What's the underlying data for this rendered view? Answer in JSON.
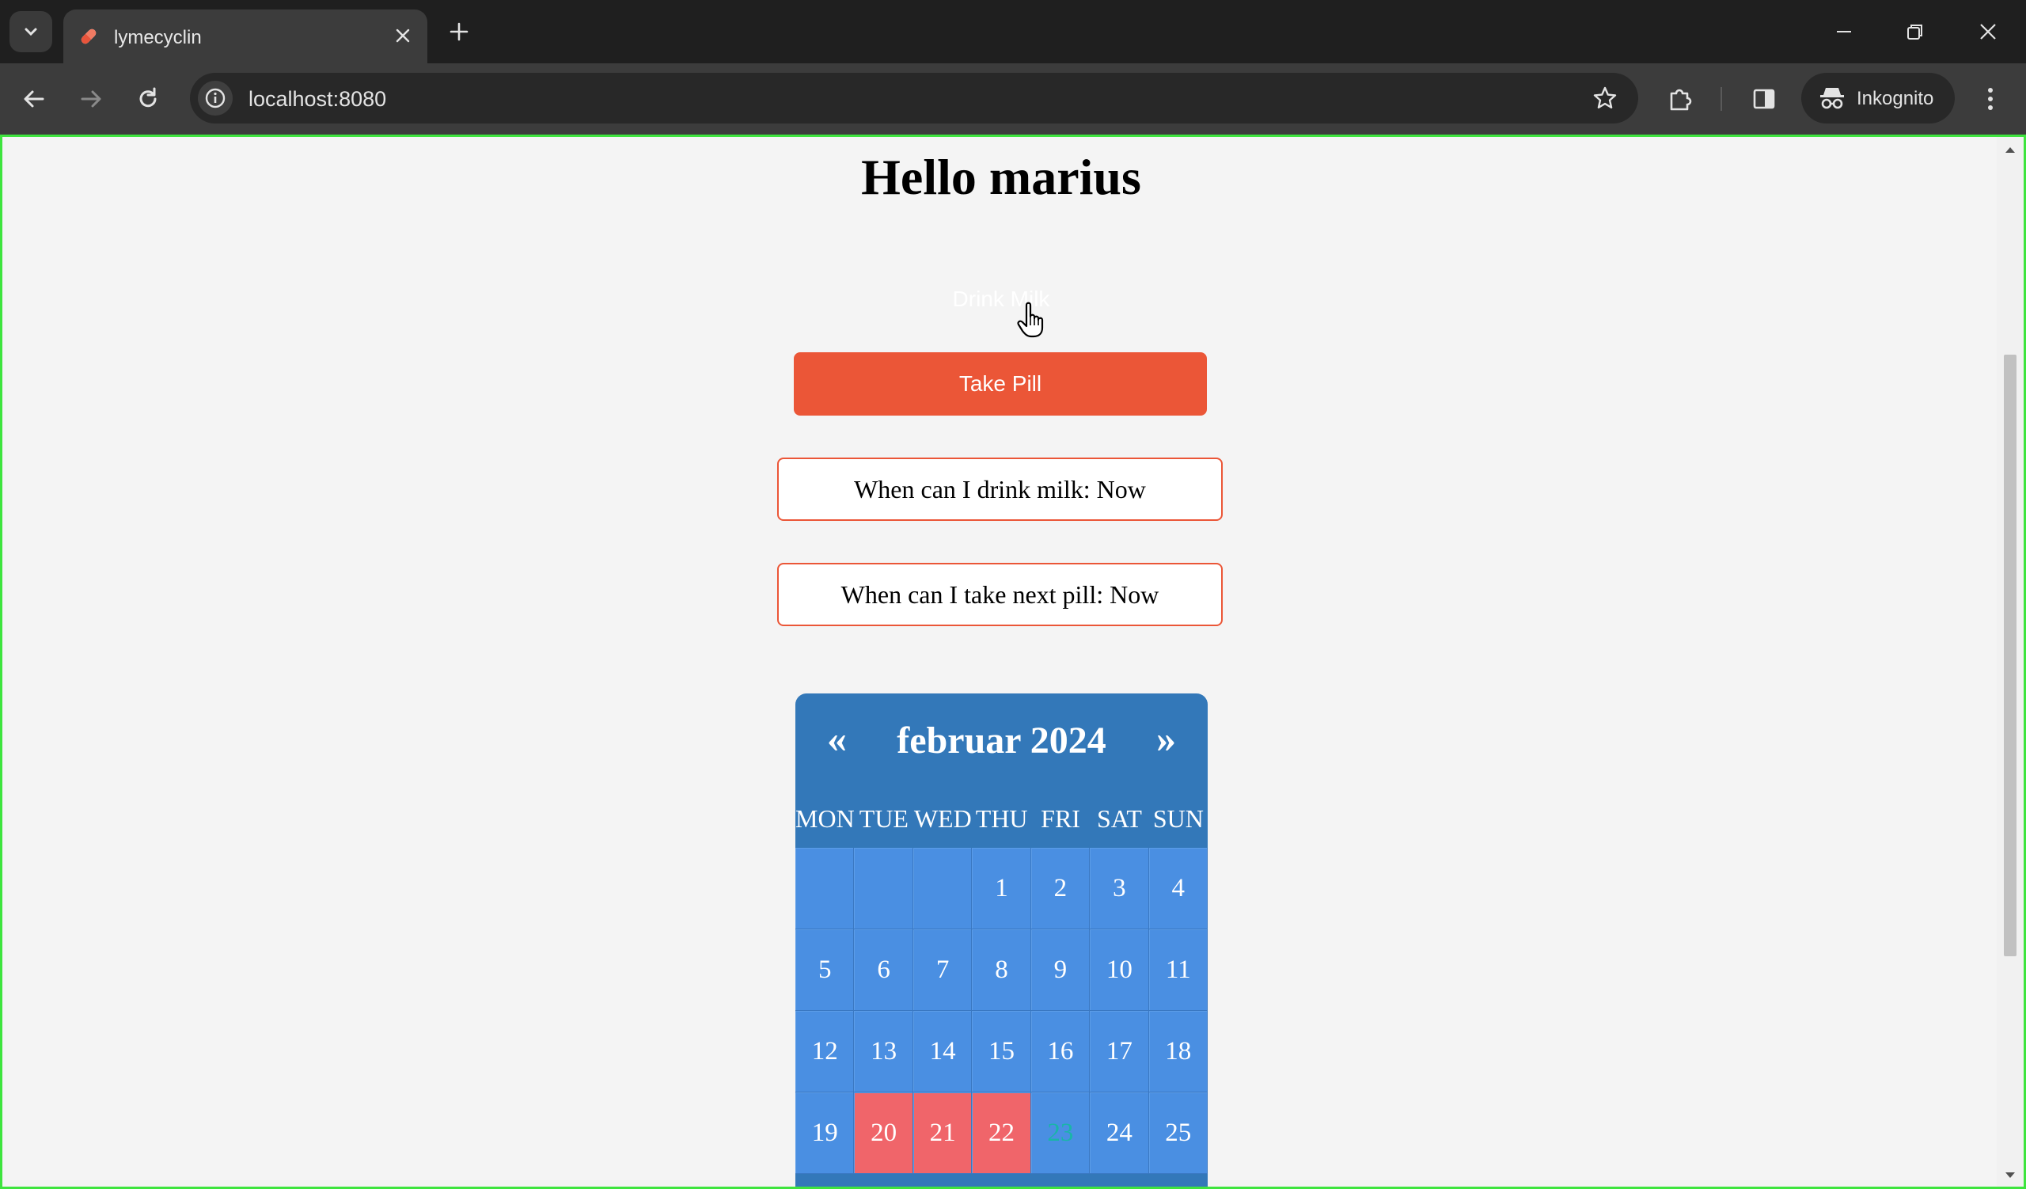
{
  "browser": {
    "tab_title": "lymecyclin",
    "url": "localhost:8080",
    "incognito_label": "Inkognito",
    "icons": {
      "tab_search": "chevron-down-icon",
      "favicon": "pill-icon",
      "tab_close": "close-icon",
      "new_tab": "plus-icon",
      "back": "arrow-left-icon",
      "forward": "arrow-right-icon",
      "reload": "reload-icon",
      "site_info": "info-icon",
      "bookmark": "star-icon",
      "extensions": "puzzle-icon",
      "side_panel": "side-panel-icon",
      "incognito": "incognito-icon",
      "menu": "kebab-menu-icon"
    }
  },
  "page": {
    "title": "Hello marius",
    "drink_milk_label": "Drink Milk",
    "take_pill_label": "Take Pill",
    "milk_status": "When can I drink milk: Now",
    "pill_status": "When can I take next pill: Now"
  },
  "calendar": {
    "prev_label": "«",
    "next_label": "»",
    "month_label": "februar 2024",
    "weekdays": [
      "MON",
      "TUE",
      "WED",
      "THU",
      "FRI",
      "SAT",
      "SUN"
    ],
    "leading_blanks": 3,
    "days": [
      "1",
      "2",
      "3",
      "4",
      "5",
      "6",
      "7",
      "8",
      "9",
      "10",
      "11",
      "12",
      "13",
      "14",
      "15",
      "16",
      "17",
      "18",
      "19",
      "20",
      "21",
      "22",
      "23",
      "24",
      "25"
    ],
    "highlighted_days": [
      "20",
      "21",
      "22"
    ],
    "today": "23"
  },
  "colors": {
    "accent_orange": "#eb5637",
    "calendar_header": "#3378b9",
    "calendar_cell": "#4a8fe2",
    "calendar_past": "#f0656a",
    "today_text": "#19b5a8",
    "focus_border": "#3ee43e"
  }
}
